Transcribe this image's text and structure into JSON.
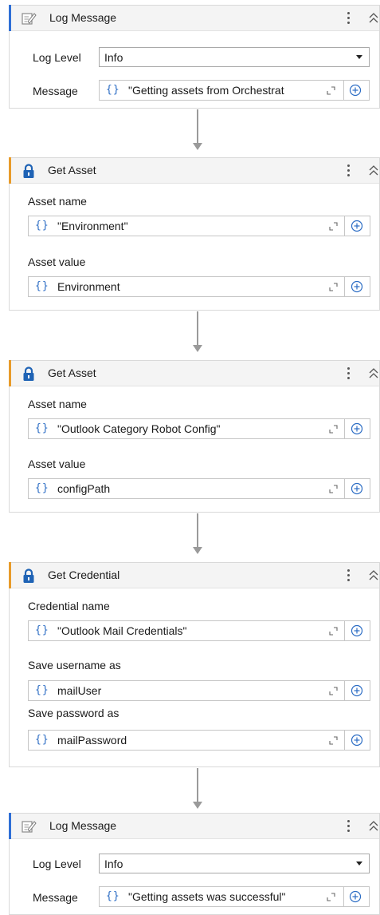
{
  "colors": {
    "accent_blue": "#2f6fd6",
    "accent_orange": "#e89b2a",
    "brace_blue": "#2b6cc4",
    "lock_blue": "#1f63b5"
  },
  "activities": [
    {
      "title": "Log Message",
      "icon": "log-message-icon",
      "fields": [
        {
          "label": "Log Level",
          "value": "Info"
        },
        {
          "label": "Message",
          "braces": "{}",
          "value": "\"Getting assets from Orchestrat"
        }
      ]
    },
    {
      "title": "Get Asset",
      "icon": "lock-icon",
      "fields": [
        {
          "label": "Asset name",
          "braces": "{}",
          "value": "\"Environment\""
        },
        {
          "label": "Asset value",
          "braces": "{}",
          "value": "Environment"
        }
      ]
    },
    {
      "title": "Get Asset",
      "icon": "lock-icon",
      "fields": [
        {
          "label": "Asset name",
          "braces": "{}",
          "value": "\"Outlook Category Robot Config\""
        },
        {
          "label": "Asset value",
          "braces": "{}",
          "value": "configPath"
        }
      ]
    },
    {
      "title": "Get Credential",
      "icon": "lock-icon",
      "fields": [
        {
          "label": "Credential name",
          "braces": "{}",
          "value": "\"Outlook Mail Credentials\""
        },
        {
          "label": "Save username as",
          "braces": "{}",
          "value": "mailUser"
        },
        {
          "label": "Save password as",
          "braces": "{}",
          "value": "mailPassword"
        }
      ]
    },
    {
      "title": "Log Message",
      "icon": "log-message-icon",
      "fields": [
        {
          "label": "Log Level",
          "value": "Info"
        },
        {
          "label": "Message",
          "braces": "{}",
          "value": "\"Getting assets was successful\""
        }
      ]
    }
  ]
}
